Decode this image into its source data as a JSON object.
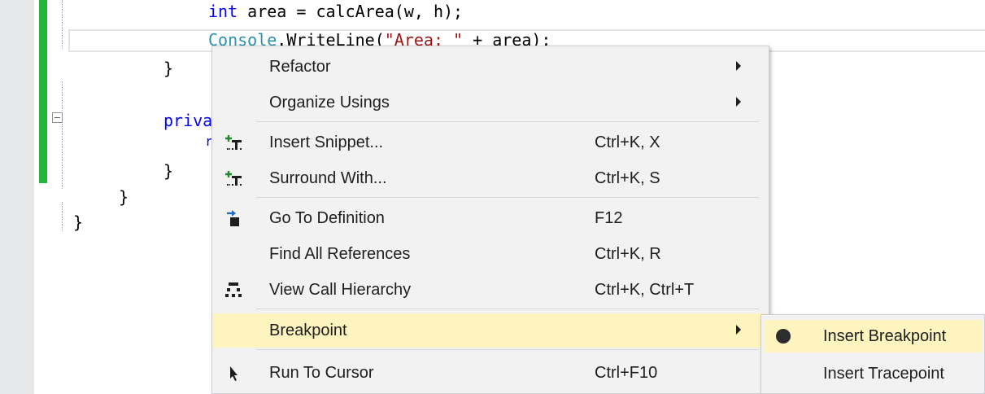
{
  "editor": {
    "code_line1": {
      "a": "int",
      "b": " area = calcArea(w, h);"
    },
    "code_line2": {
      "a": "Console",
      "b": ".WriteLine(",
      "c": "\"Area: \"",
      "d": " + area);"
    },
    "brace_close_method": "}",
    "private_kw": "priva",
    "brace_close_method2": "}",
    "brace_close_class": "}",
    "brace_close_ns": "}",
    "partial_char": "r"
  },
  "context_menu": {
    "items": [
      {
        "label": "Refactor",
        "shortcut": "",
        "submenu": true,
        "icon": ""
      },
      {
        "label": "Organize Usings",
        "shortcut": "",
        "submenu": true,
        "icon": ""
      },
      {
        "label": "Insert Snippet...",
        "shortcut": "Ctrl+K, X",
        "submenu": false,
        "icon": "snippet-icon"
      },
      {
        "label": "Surround With...",
        "shortcut": "Ctrl+K, S",
        "submenu": false,
        "icon": "surround-icon"
      },
      {
        "label": "Go To Definition",
        "shortcut": "F12",
        "submenu": false,
        "icon": "go-to-definition-icon"
      },
      {
        "label": "Find All References",
        "shortcut": "Ctrl+K, R",
        "submenu": false,
        "icon": ""
      },
      {
        "label": "View Call Hierarchy",
        "shortcut": "Ctrl+K, Ctrl+T",
        "submenu": false,
        "icon": "call-hierarchy-icon"
      },
      {
        "label": "Breakpoint",
        "shortcut": "",
        "submenu": true,
        "icon": "",
        "highlighted": true
      },
      {
        "label": "Run To Cursor",
        "shortcut": "Ctrl+F10",
        "submenu": false,
        "icon": "cursor-arrow-icon"
      }
    ]
  },
  "breakpoint_submenu": {
    "items": [
      {
        "label": "Insert Breakpoint",
        "icon": "breakpoint-dot-icon",
        "highlighted": true
      },
      {
        "label": "Insert Tracepoint",
        "icon": ""
      }
    ]
  },
  "colors": {
    "highlight": "#fdf4bf",
    "change_bar": "#24b43a",
    "keyword": "#0000ff",
    "type": "#2b91af",
    "string": "#a31515"
  }
}
